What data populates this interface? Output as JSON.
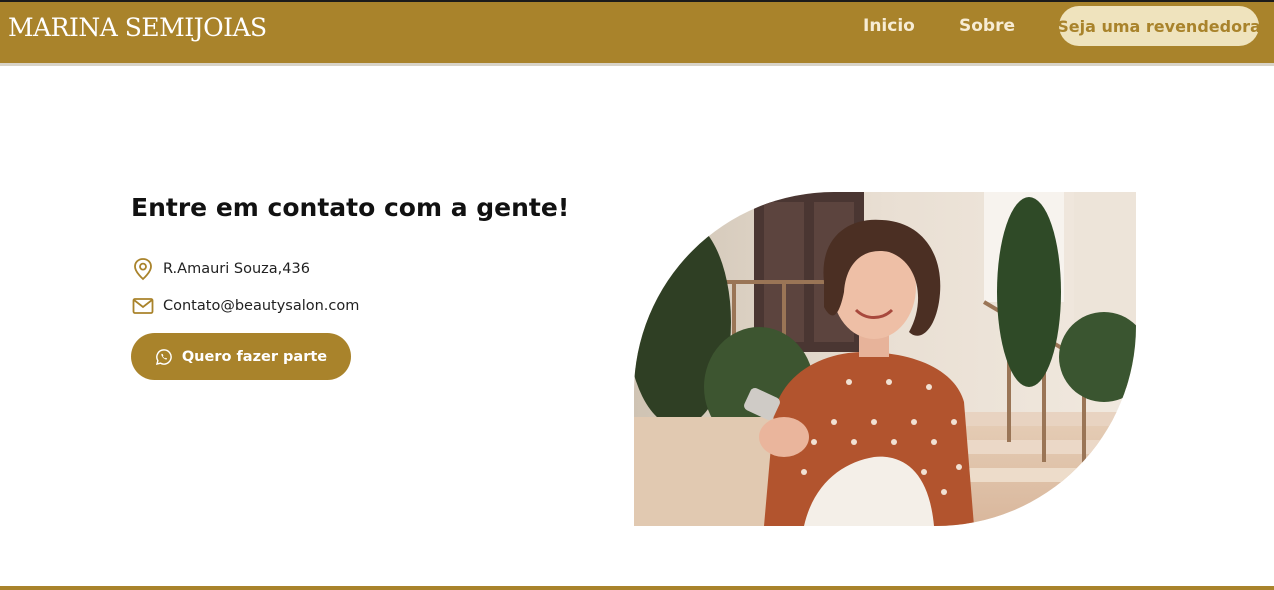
{
  "brand": {
    "logo_text": "MARINA SEMIJOIAS"
  },
  "nav": {
    "items": [
      {
        "label": "Inicio"
      },
      {
        "label": "Sobre"
      }
    ],
    "cta_label": "Seja uma revendedora"
  },
  "contact": {
    "title": "Entre em contato com a gente!",
    "address": "R.Amauri Souza,436",
    "email": "Contato@beautysalon.com",
    "button_label": "Quero fazer parte",
    "icons": [
      "location-pin-icon",
      "envelope-icon",
      "whatsapp-icon"
    ]
  },
  "colors": {
    "brand_gold": "#a9832b",
    "cta_pill_bg": "#efe3bd",
    "header_text": "#f7ecd4"
  }
}
